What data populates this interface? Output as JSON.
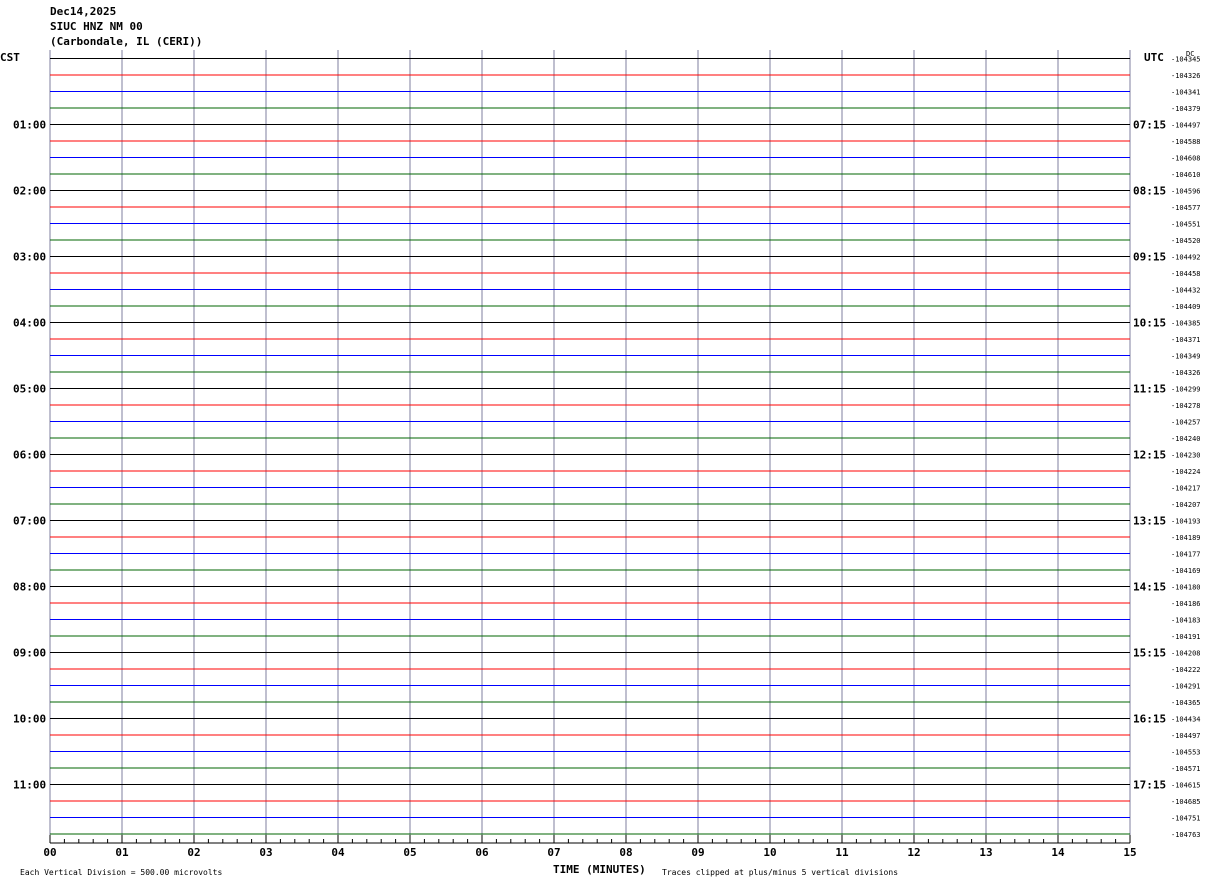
{
  "header": {
    "date": "Dec14,2025",
    "station": "SIUC HNZ NM 00",
    "location": "(Carbondale, IL (CERI))"
  },
  "labels": {
    "left_tz": "CST",
    "right_tz": "UTC",
    "dc": "DC",
    "xlabel": "TIME (MINUTES)",
    "scale_note": "Each Vertical Division =  500.00 microvolts",
    "clip_note": "Traces clipped at plus/minus 5 vertical divisions"
  },
  "colors": {
    "trace_cycle": [
      "#000000",
      "#ff0000",
      "#0000ff",
      "#006400"
    ],
    "gridline": "#7f7f9f"
  },
  "chart_data": {
    "type": "line",
    "xlim": [
      0,
      15
    ],
    "x_ticks": [
      "00",
      "01",
      "02",
      "03",
      "04",
      "05",
      "06",
      "07",
      "08",
      "09",
      "10",
      "11",
      "12",
      "13",
      "14",
      "15"
    ],
    "trace_count": 48,
    "hour_labels_left": [
      "01:00",
      "02:00",
      "03:00",
      "04:00",
      "05:00",
      "06:00",
      "07:00",
      "08:00",
      "09:00",
      "10:00",
      "11:00"
    ],
    "hour_labels_right": [
      "07:15",
      "08:15",
      "09:15",
      "10:15",
      "11:15",
      "12:15",
      "13:15",
      "14:15",
      "15:15",
      "16:15",
      "17:15"
    ],
    "dc_offsets": [
      "-104345",
      "-104326",
      "-104341",
      "-104379",
      "-104497",
      "-104588",
      "-104608",
      "-104610",
      "-104596",
      "-104577",
      "-104551",
      "-104520",
      "-104492",
      "-104458",
      "-104432",
      "-104409",
      "-104385",
      "-104371",
      "-104349",
      "-104326",
      "-104299",
      "-104278",
      "-104257",
      "-104240",
      "-104230",
      "-104224",
      "-104217",
      "-104207",
      "-104193",
      "-104189",
      "-104177",
      "-104169",
      "-104180",
      "-104186",
      "-104183",
      "-104191",
      "-104208",
      "-104222",
      "-104291",
      "-104365",
      "-104434",
      "-104497",
      "-104553",
      "-104571",
      "-104615",
      "-104685",
      "-104751",
      "-104763"
    ]
  }
}
